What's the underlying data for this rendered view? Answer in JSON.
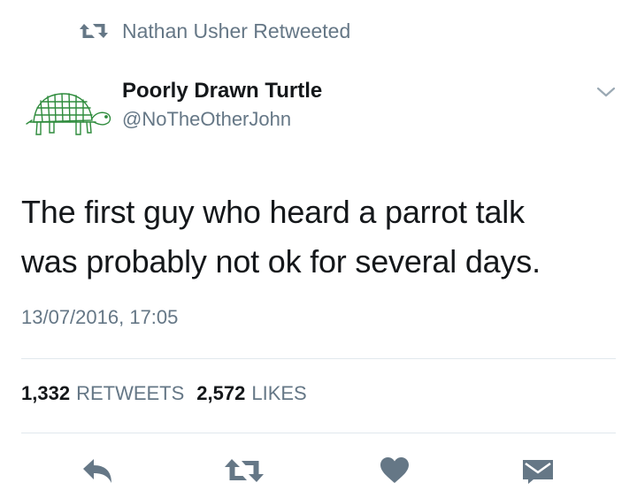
{
  "retweet_header": {
    "text": "Nathan Usher Retweeted",
    "icon": "retweet-icon"
  },
  "author": {
    "display_name": "Poorly Drawn Turtle",
    "handle": "@NoTheOtherJohn",
    "avatar": "turtle-drawing-avatar"
  },
  "tweet": {
    "line1": "The first guy who heard a parrot talk",
    "line2": "was probably not ok for several days.",
    "timestamp": "13/07/2016, 17:05"
  },
  "stats": {
    "retweets_count": "1,332",
    "retweets_label": "RETWEETS",
    "likes_count": "2,572",
    "likes_label": "LIKES"
  },
  "actions": [
    {
      "name": "reply",
      "icon": "reply-icon"
    },
    {
      "name": "retweet",
      "icon": "retweet-icon"
    },
    {
      "name": "like",
      "icon": "heart-icon"
    },
    {
      "name": "direct-message",
      "icon": "envelope-icon"
    }
  ],
  "colors": {
    "text": "#14171a",
    "secondary": "#657786",
    "divider": "#e1e8ed",
    "icon": "#657786",
    "avatar_green": "#2e8b3c"
  }
}
